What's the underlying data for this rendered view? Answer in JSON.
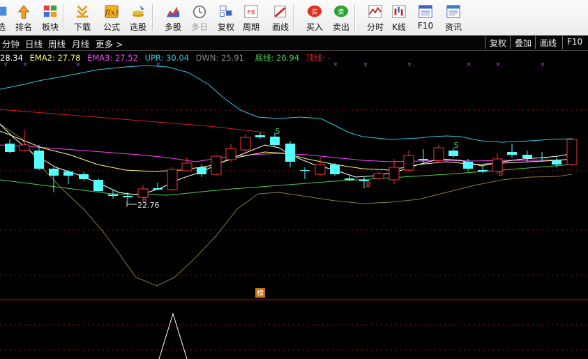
{
  "toolbar": {
    "buttons": [
      {
        "label": "选",
        "icon": "select-icon"
      },
      {
        "label": "排名",
        "icon": "ranking-icon"
      },
      {
        "label": "板块",
        "icon": "sector-icon"
      },
      {
        "label": "下载",
        "icon": "download-icon"
      },
      {
        "label": "公式",
        "icon": "formula-icon"
      },
      {
        "label": "选股",
        "icon": "stock-picker-icon"
      },
      {
        "label": "多股",
        "icon": "multi-stock-icon"
      },
      {
        "label": "多日",
        "icon": "multi-day-icon"
      },
      {
        "label": "复权",
        "icon": "adjust-icon"
      },
      {
        "label": "周期",
        "icon": "period-icon",
        "badge": "F8"
      },
      {
        "label": "画线",
        "icon": "draw-line-icon"
      },
      {
        "label": "买入",
        "icon": "buy-icon",
        "badge": "买"
      },
      {
        "label": "卖出",
        "icon": "sell-icon",
        "badge": "卖"
      },
      {
        "label": "分时",
        "icon": "intraday-icon"
      },
      {
        "label": "K线",
        "icon": "kline-icon"
      },
      {
        "label": "F10",
        "icon": "f10-icon"
      },
      {
        "label": "资讯",
        "icon": "news-icon"
      }
    ]
  },
  "period_bar": {
    "items": [
      "分钟",
      "日线",
      "周线",
      "月线",
      "更多 >"
    ],
    "right_buttons": [
      "复权",
      "叠加",
      "画线",
      "F10"
    ]
  },
  "legend": {
    "ema1": "28.34",
    "ema2": "EMA2: 27.78",
    "ema3": "EMA3: 27.52",
    "upr": "UPR: 30.04",
    "dwn": "DWN: 25.91",
    "bottom_line": "底线: 26.94",
    "top_line": "顶线: -"
  },
  "chart_data": {
    "type": "candlestick",
    "low_annotation": "22.76",
    "signal_s": "S",
    "signal_b": "B",
    "panel_tag": "榜",
    "colors": {
      "up": "#ff3232",
      "down": "#54ffff",
      "ema1": "#ffffff",
      "ema2": "#ffff80",
      "ema3": "#ff40ff",
      "upr": "#30c8e0",
      "dwn": "#8a7a3a",
      "bottom_line": "#4ad04a",
      "top_line": "#d02020",
      "gridline": "#a01010"
    }
  }
}
